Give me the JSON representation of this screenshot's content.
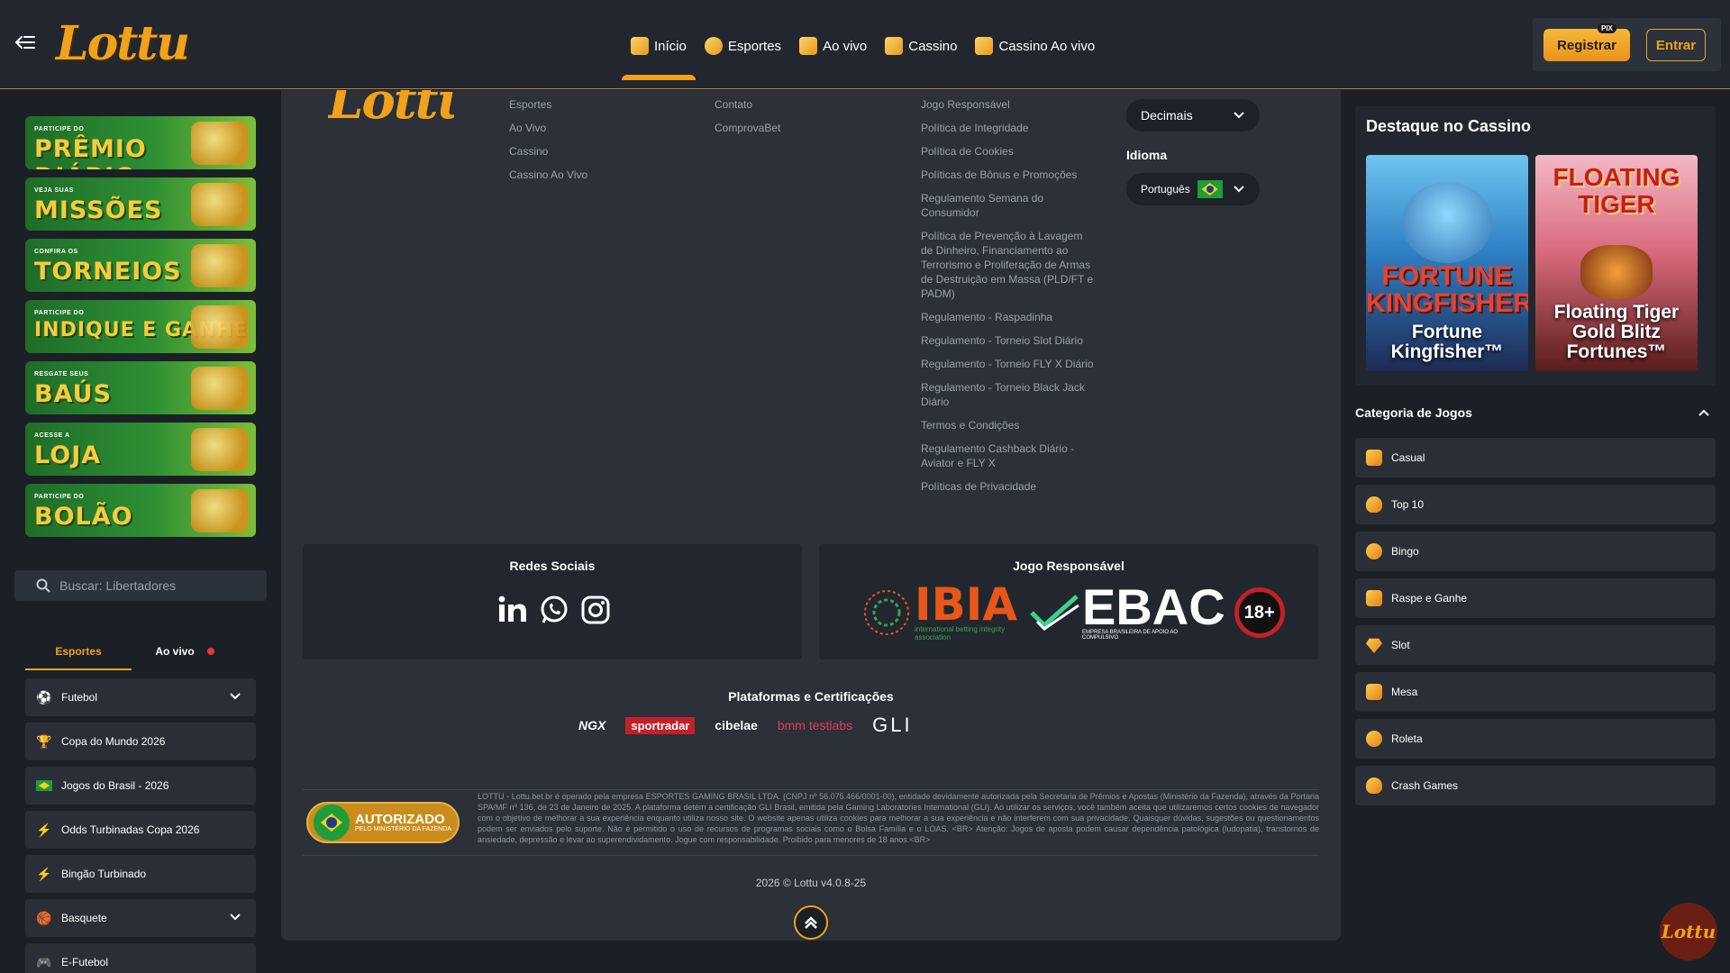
{
  "header": {
    "logo_text": "Lottu",
    "nav": [
      {
        "label": "Início",
        "icon": "home-icon",
        "active": true
      },
      {
        "label": "Esportes",
        "icon": "sports-icon"
      },
      {
        "label": "Ao vivo",
        "icon": "live-tv-icon"
      },
      {
        "label": "Cassino",
        "icon": "casino-icon"
      },
      {
        "label": "Cassino Ao vivo",
        "icon": "live-casino-icon"
      }
    ],
    "register_label": "Registrar",
    "pix_label": "PIX",
    "login_label": "Entrar",
    "accent": "#f0a21c"
  },
  "left": {
    "banners": [
      {
        "small": "PARTICIPE DO",
        "big": "PRÊMIO DIÁRIO"
      },
      {
        "small": "VEJA SUAS",
        "big": "MISSÕES"
      },
      {
        "small": "CONFIRA OS",
        "big": "TORNEIOS"
      },
      {
        "small": "PARTICIPE DO",
        "big": "INDIQUE E GANHE"
      },
      {
        "small": "RESGATE SEUS",
        "big": "BAÚS"
      },
      {
        "small": "ACESSE A",
        "big": "LOJA"
      },
      {
        "small": "PARTICIPE DO",
        "big": "BOLÃO"
      }
    ],
    "search_placeholder": "Buscar: Libertadores",
    "tabs": {
      "sports": "Esportes",
      "live": "Ao vivo"
    },
    "sports": [
      {
        "label": "Futebol",
        "icon": "soccer-ball-icon",
        "expandable": true
      },
      {
        "label": "Copa do Mundo 2026",
        "icon": "trophy-icon"
      },
      {
        "label": "Jogos do Brasil - 2026",
        "icon": "brazil-flag-icon"
      },
      {
        "label": "Odds Turbinadas Copa 2026",
        "icon": "lightning-icon"
      },
      {
        "label": "Bingão Turbinado",
        "icon": "lightning-icon"
      },
      {
        "label": "Basquete",
        "icon": "basketball-icon",
        "expandable": true
      },
      {
        "label": "E-Futebol",
        "icon": "gamepad-icon"
      }
    ]
  },
  "footer": {
    "col1": [
      "Esportes",
      "Ao Vivo",
      "Cassino",
      "Cassino Ao Vivo"
    ],
    "col2": [
      "Contato",
      "ComprovaBet"
    ],
    "col3": [
      "Jogo Responsável",
      "Política de Integridade",
      "Política de Cookies",
      "Políticas de Bônus e Promoções",
      "Regulamento Semana do Consumidor",
      "Política de Prevenção à Lavagem de Dinheiro, Financiamento ao Terrorismo e Proliferação de Armas de Destruição em Massa (PLD/FT e PADM)",
      "Regulamento - Raspadinha",
      "Regulamento - Torneio Slot Diário",
      "Regulamento - Torneio FLY X Diário",
      "Regulamento - Torneio Black Jack Diário",
      "Termos e Condições",
      "Regulamento Cashback Diário - Aviator e FLY X",
      "Políticas de Privacidade"
    ],
    "odds_format": "Decimais",
    "language_label": "Idioma",
    "language_value": "Português",
    "social_title": "Redes Sociais",
    "social_icons": [
      "linkedin-icon",
      "whatsapp-icon",
      "instagram-icon"
    ],
    "responsible_title": "Jogo Responsável",
    "ibia_text": "IBIA",
    "ibia_sub": "international betting integrity association",
    "ebac_text": "EBAC",
    "ebac_sub": "EMPRESA BRASILEIRA DE APOIO AO COMPULSIVO",
    "age_badge": "18+",
    "cert_title": "Plataformas e Certificações",
    "cert_logos": [
      "NGX",
      "sportradar",
      "cibelae",
      "bmm testlabs",
      "GLI"
    ],
    "authorized_title": "AUTORIZADO",
    "authorized_sub": "PELO MINISTÉRIO DA FAZENDA",
    "legal_text": "LOTTU - Lottu.bet.br é operado pela empresa ESPORTES GAMING BRASIL LTDA. (CNPJ nº 56.075.466/0001-00), entidade devidamente autorizada pela Secretaria de Prêmios e Apostas (Ministério da Fazenda), através da Portaria SPA/MF nº 136, de 23 de Janeiro de 2025. A plataforma detém a certificação GLI Brasil, emitida pela Gaming Laboratories International (GLI). Ao utilizar os serviços, você também aceita que utilizaremos certos cookies de navegador com o objetivo de melhorar a sua experiência enquanto utiliza nosso site. O website apenas utiliza cookies para melhorar a sua experiência e não interferem com sua privacidade. Quaisquer dúvidas, sugestões ou questionamentos podem ser enviados pelo suporte. Não é permitido o uso de recursos de programas sociais como o Bolsa Família e o LOAS. <BR> Atenção: Jogos de aposta podem causar dependência patológica (ludopatia), transtornos de ansiedade, depressão e levar ao superendividamento. Jogue com responsabilidade. Proibido para menores de 18 anos.<BR>",
    "copyright": "2026 © Lottu v4.0.8-25"
  },
  "right": {
    "featured_title": "Destaque no Cassino",
    "games": [
      {
        "name": "Fortune Kingfisher™",
        "art_title": "FORTUNE KINGFISHER"
      },
      {
        "name": "Floating Tiger Gold Blitz Fortunes™",
        "art_title": "FLOATING TIGER"
      }
    ],
    "categories_title": "Categoria de Jogos",
    "categories": [
      "Casual",
      "Top 10",
      "Bingo",
      "Raspe e Ganhe",
      "Slot",
      "Mesa",
      "Roleta",
      "Crash Games"
    ]
  }
}
